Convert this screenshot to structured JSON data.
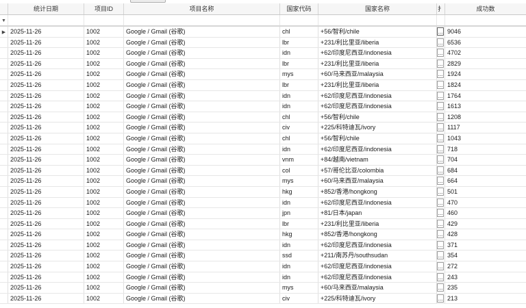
{
  "grid": {
    "columns": [
      "统计日期",
      "项目ID",
      "项目名称",
      "国家代码",
      "国家名称",
      "扌",
      "成功数"
    ],
    "filter_icon": "funnel-icon",
    "current_row_icon": "row-pointer-icon",
    "cell_button_label": "...",
    "rows": [
      [
        "2025-11-26",
        "1002",
        "Google / Gmail (谷歌)",
        "chl",
        "+56/智利/chile",
        "9046"
      ],
      [
        "2025-11-26",
        "1002",
        "Google / Gmail (谷歌)",
        "lbr",
        "+231/利比里亚/liberia",
        "6536"
      ],
      [
        "2025-11-26",
        "1002",
        "Google / Gmail (谷歌)",
        "idn",
        "+62/印度尼西亚/indonesia",
        "4702"
      ],
      [
        "2025-11-26",
        "1002",
        "Google / Gmail (谷歌)",
        "lbr",
        "+231/利比里亚/liberia",
        "2829"
      ],
      [
        "2025-11-26",
        "1002",
        "Google / Gmail (谷歌)",
        "mys",
        "+60/马来西亚/malaysia",
        "1924"
      ],
      [
        "2025-11-26",
        "1002",
        "Google / Gmail (谷歌)",
        "lbr",
        "+231/利比里亚/liberia",
        "1824"
      ],
      [
        "2025-11-26",
        "1002",
        "Google / Gmail (谷歌)",
        "idn",
        "+62/印度尼西亚/indonesia",
        "1764"
      ],
      [
        "2025-11-26",
        "1002",
        "Google / Gmail (谷歌)",
        "idn",
        "+62/印度尼西亚/indonesia",
        "1613"
      ],
      [
        "2025-11-26",
        "1002",
        "Google / Gmail (谷歌)",
        "chl",
        "+56/智利/chile",
        "1208"
      ],
      [
        "2025-11-26",
        "1002",
        "Google / Gmail (谷歌)",
        "civ",
        "+225/科特迪瓦/ivory",
        "1117"
      ],
      [
        "2025-11-26",
        "1002",
        "Google / Gmail (谷歌)",
        "chl",
        "+56/智利/chile",
        "1043"
      ],
      [
        "2025-11-26",
        "1002",
        "Google / Gmail (谷歌)",
        "idn",
        "+62/印度尼西亚/indonesia",
        "718"
      ],
      [
        "2025-11-26",
        "1002",
        "Google / Gmail (谷歌)",
        "vnm",
        "+84/越南/vietnam",
        "704"
      ],
      [
        "2025-11-26",
        "1002",
        "Google / Gmail (谷歌)",
        "col",
        "+57/哥伦比亚/colombia",
        "684"
      ],
      [
        "2025-11-26",
        "1002",
        "Google / Gmail (谷歌)",
        "mys",
        "+60/马来西亚/malaysia",
        "664"
      ],
      [
        "2025-11-26",
        "1002",
        "Google / Gmail (谷歌)",
        "hkg",
        "+852/香港/hongkong",
        "501"
      ],
      [
        "2025-11-26",
        "1002",
        "Google / Gmail (谷歌)",
        "idn",
        "+62/印度尼西亚/indonesia",
        "470"
      ],
      [
        "2025-11-26",
        "1002",
        "Google / Gmail (谷歌)",
        "jpn",
        "+81/日本/japan",
        "460"
      ],
      [
        "2025-11-26",
        "1002",
        "Google / Gmail (谷歌)",
        "lbr",
        "+231/利比里亚/liberia",
        "429"
      ],
      [
        "2025-11-26",
        "1002",
        "Google / Gmail (谷歌)",
        "hkg",
        "+852/香港/hongkong",
        "428"
      ],
      [
        "2025-11-26",
        "1002",
        "Google / Gmail (谷歌)",
        "idn",
        "+62/印度尼西亚/indonesia",
        "371"
      ],
      [
        "2025-11-26",
        "1002",
        "Google / Gmail (谷歌)",
        "ssd",
        "+211/南苏丹/southsudan",
        "354"
      ],
      [
        "2025-11-26",
        "1002",
        "Google / Gmail (谷歌)",
        "idn",
        "+62/印度尼西亚/indonesia",
        "272"
      ],
      [
        "2025-11-26",
        "1002",
        "Google / Gmail (谷歌)",
        "idn",
        "+62/印度尼西亚/indonesia",
        "243"
      ],
      [
        "2025-11-26",
        "1002",
        "Google / Gmail (谷歌)",
        "mys",
        "+60/马来西亚/malaysia",
        "235"
      ],
      [
        "2025-11-26",
        "1002",
        "Google / Gmail (谷歌)",
        "civ",
        "+225/科特迪瓦/ivory",
        "213"
      ]
    ]
  }
}
